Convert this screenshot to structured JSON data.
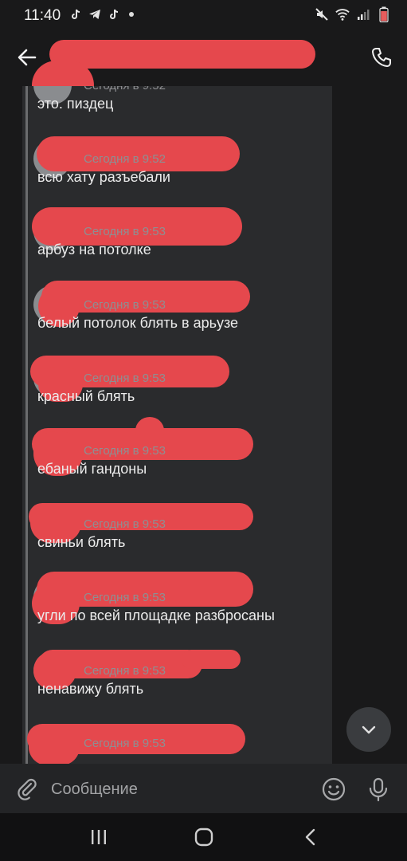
{
  "status_bar": {
    "time": "11:40"
  },
  "composer": {
    "placeholder": "Сообщение"
  },
  "messages": [
    {
      "time": "Сегодня в 9:52",
      "text": "это. пиздец"
    },
    {
      "time": "Сегодня в 9:52",
      "text": "всю хату разъебали"
    },
    {
      "time": "Сегодня в 9:53",
      "text": "арбуз на потолке"
    },
    {
      "time": "Сегодня в 9:53",
      "text": "белый потолок блять в арьузе"
    },
    {
      "time": "Сегодня в 9:53",
      "text": "красный блять"
    },
    {
      "time": "Сегодня в 9:53",
      "text": "ебаный гандоны"
    },
    {
      "time": "Сегодня в 9:53",
      "text": "свиньи блять"
    },
    {
      "time": "Сегодня в 9:53",
      "text": "угли по всей площадке разбросаны"
    },
    {
      "time": "Сегодня в 9:53",
      "text": "ненавижу блять"
    },
    {
      "time": "Сегодня в 9:53",
      "text": ""
    }
  ],
  "colors": {
    "background": "#19191a",
    "thread_panel": "#2a2b2d",
    "redaction": "#e5484d",
    "secondary_text": "#8e8f92"
  }
}
